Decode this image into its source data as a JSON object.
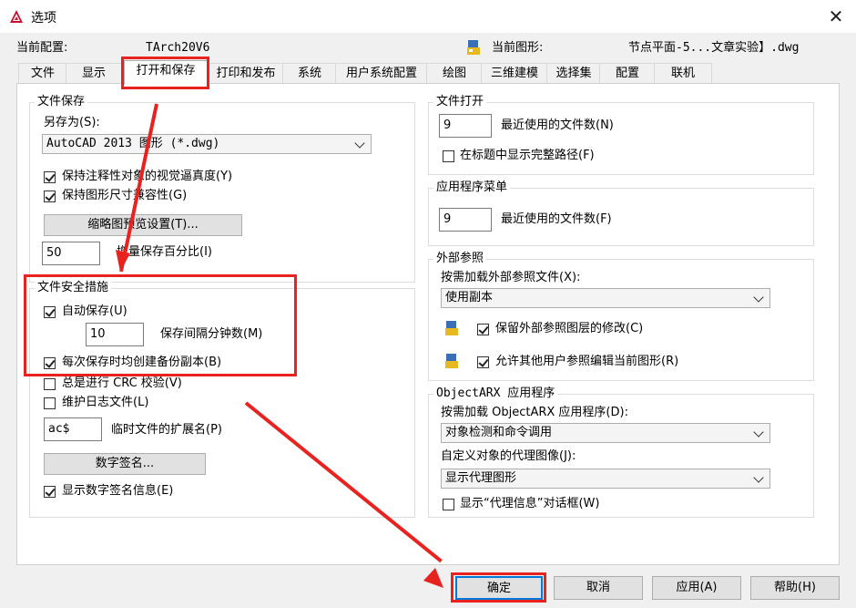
{
  "window": {
    "title": "选项",
    "close_glyph": "✕"
  },
  "header": {
    "config_label": "当前配置:",
    "config_value": "TArch20V6",
    "drawing_label": "当前图形:",
    "drawing_value": "节点平面-5...文章实验】.dwg"
  },
  "tabs": [
    "文件",
    "显示",
    "打开和保存",
    "打印和发布",
    "系统",
    "用户系统配置",
    "绘图",
    "三维建模",
    "选择集",
    "配置",
    "联机"
  ],
  "active_tab": "打开和保存",
  "file_save": {
    "title": "文件保存",
    "save_as_label": "另存为(S):",
    "save_as_value": "AutoCAD 2013 图形 (*.dwg)",
    "annotative_label": "保持注释性对象的视觉逼真度(Y)",
    "annotative_checked": true,
    "drawing_size_label": "保持图形尺寸兼容性(G)",
    "drawing_size_checked": true,
    "thumbnail_button": "缩略图预览设置(T)...",
    "incremental_value": "50",
    "incremental_label": "增量保存百分比(I)"
  },
  "file_safety": {
    "title": "文件安全措施",
    "autosave_label": "自动保存(U)",
    "autosave_checked": true,
    "interval_value": "10",
    "interval_label": "保存间隔分钟数(M)",
    "backup_label": "每次保存时均创建备份副本(B)",
    "backup_checked": true,
    "crc_label": "总是进行 CRC 校验(V)",
    "crc_checked": false,
    "log_label": "维护日志文件(L)",
    "log_checked": false,
    "temp_ext_value": "ac$",
    "temp_ext_label": "临时文件的扩展名(P)",
    "digital_sig_button": "数字签名...",
    "show_sig_label": "显示数字签名信息(E)",
    "show_sig_checked": true
  },
  "file_open": {
    "title": "文件打开",
    "recent_value": "9",
    "recent_label": "最近使用的文件数(N)",
    "fullpath_label": "在标题中显示完整路径(F)",
    "fullpath_checked": false
  },
  "app_menu": {
    "title": "应用程序菜单",
    "recent_value": "9",
    "recent_label": "最近使用的文件数(F)"
  },
  "xref": {
    "title": "外部参照",
    "demand_label": "按需加载外部参照文件(X):",
    "demand_value": "使用副本",
    "retain_label": "保留外部参照图层的修改(C)",
    "retain_checked": true,
    "allow_label": "允许其他用户参照编辑当前图形(R)",
    "allow_checked": true
  },
  "objectarx": {
    "title": "ObjectARX 应用程序",
    "demand_label": "按需加载 ObjectARX 应用程序(D):",
    "demand_value": "对象检测和命令调用",
    "proxy_label": "自定义对象的代理图像(J):",
    "proxy_value": "显示代理图形",
    "proxy_dialog_label": "显示“代理信息”对话框(W)",
    "proxy_dialog_checked": false
  },
  "footer": {
    "ok": "确定",
    "cancel": "取消",
    "apply": "应用(A)",
    "help": "帮助(H)"
  },
  "colors": {
    "highlight": "#e8231f",
    "ok_border": "#0078d7"
  },
  "icons": [
    "autocad-logo-icon",
    "drawing-file-icon",
    "layer-stack-icon"
  ]
}
